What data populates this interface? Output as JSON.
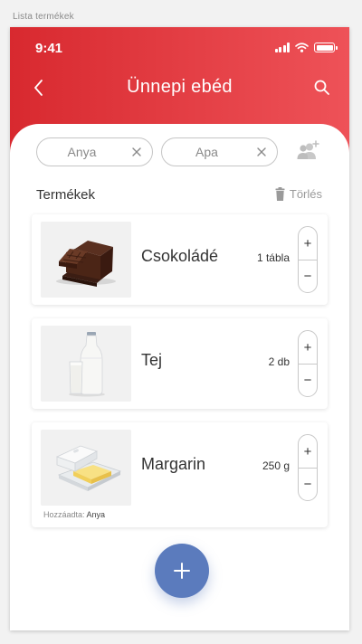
{
  "artboard_label": "Lista termékek",
  "status_bar": {
    "time": "9:41",
    "signal_icon": "signal-icon",
    "wifi_icon": "wifi-icon",
    "battery_icon": "battery-icon"
  },
  "nav": {
    "title": "Ünnepi ebéd",
    "back_icon": "chevron-left-icon",
    "search_icon": "search-icon"
  },
  "colors": {
    "header_start": "#d8292f",
    "header_end": "#ee5258",
    "fab": "#5b7bbd",
    "text": "#333333",
    "muted": "#9a9a9a"
  },
  "members": [
    {
      "name": "Anya",
      "remove_icon": "close-icon"
    },
    {
      "name": "Apa",
      "remove_icon": "close-icon"
    }
  ],
  "add_member_icon": "add-user-icon",
  "products_section": {
    "title": "Termékek",
    "delete_label": "Törlés",
    "delete_icon": "trash-icon"
  },
  "items": [
    {
      "name": "Csokoládé",
      "quantity": "1 tábla",
      "image": "chocolate-image",
      "plus": "+",
      "minus": "−"
    },
    {
      "name": "Tej",
      "quantity": "2 db",
      "image": "milk-image",
      "plus": "+",
      "minus": "−"
    },
    {
      "name": "Margarin",
      "quantity": "250 g",
      "image": "margarine-image",
      "plus": "+",
      "minus": "−",
      "added_by_label": "Hozzáadta:",
      "added_by": "Anya"
    }
  ],
  "fab": {
    "icon": "plus-icon"
  }
}
